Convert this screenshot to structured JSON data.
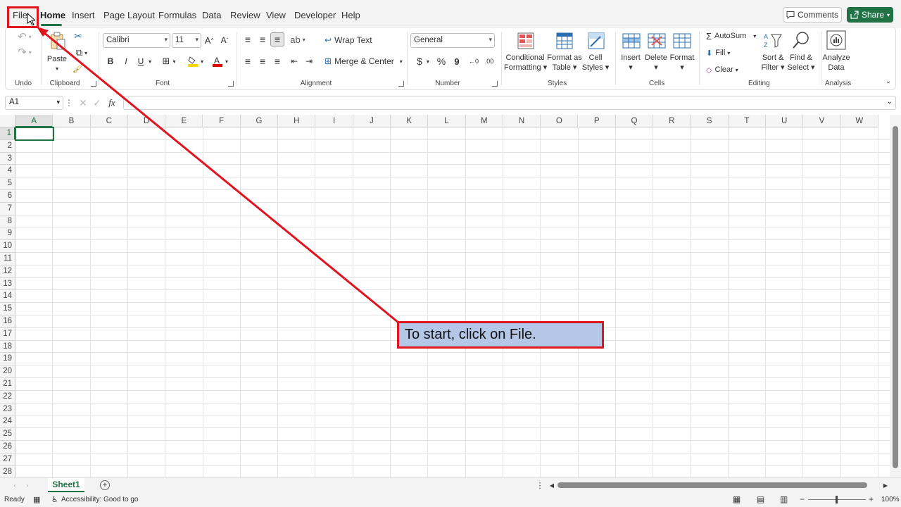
{
  "menu": {
    "tabs": [
      "File",
      "Home",
      "Insert",
      "Page Layout",
      "Formulas",
      "Data",
      "Review",
      "View",
      "Developer",
      "Help"
    ],
    "comments_label": "Comments",
    "share_label": "Share"
  },
  "ribbon": {
    "groups": [
      "Undo",
      "Clipboard",
      "Font",
      "Alignment",
      "Number",
      "Styles",
      "Cells",
      "Editing",
      "Analysis"
    ],
    "paste_label": "Paste",
    "font_name": "Calibri",
    "font_size": "11",
    "bold": "B",
    "italic": "I",
    "underline": "U",
    "wrap_text": "Wrap Text",
    "merge_center": "Merge & Center",
    "number_format": "General",
    "currency": "$",
    "percent": "%",
    "comma": "9",
    "inc_decimal": "←0",
    "dec_decimal": ".00",
    "conditional_formatting": [
      "Conditional",
      "Formatting"
    ],
    "format_as_table": [
      "Format as",
      "Table"
    ],
    "cell_styles": [
      "Cell",
      "Styles"
    ],
    "insert": "Insert",
    "delete": "Delete",
    "format": "Format",
    "autosum": "AutoSum",
    "fill": "Fill",
    "clear": "Clear",
    "sort_filter": [
      "Sort &",
      "Filter"
    ],
    "find_select": [
      "Find &",
      "Select"
    ],
    "analyze_data": [
      "Analyze",
      "Data"
    ]
  },
  "formula_bar": {
    "name_box": "A1",
    "fx": "fx",
    "value": ""
  },
  "grid": {
    "columns": [
      "A",
      "B",
      "C",
      "D",
      "E",
      "F",
      "G",
      "H",
      "I",
      "J",
      "K",
      "L",
      "M",
      "N",
      "O",
      "P",
      "Q",
      "R",
      "S",
      "T",
      "U",
      "V",
      "W"
    ],
    "rows": [
      "1",
      "2",
      "3",
      "4",
      "5",
      "6",
      "7",
      "8",
      "9",
      "10",
      "11",
      "12",
      "13",
      "14",
      "15",
      "16",
      "17",
      "18",
      "19",
      "20",
      "21",
      "22",
      "23",
      "24",
      "25",
      "26",
      "27",
      "28"
    ],
    "selected_cell": "A1"
  },
  "sheets": [
    "Sheet1"
  ],
  "status": {
    "ready": "Ready",
    "accessibility": "Accessibility: Good to go",
    "zoom": "100%"
  },
  "tutorial": {
    "callout": "To start, click on File."
  },
  "colors": {
    "accent": "#217346",
    "highlight": "#e0141e",
    "callout_bg": "#b4c7e7"
  }
}
